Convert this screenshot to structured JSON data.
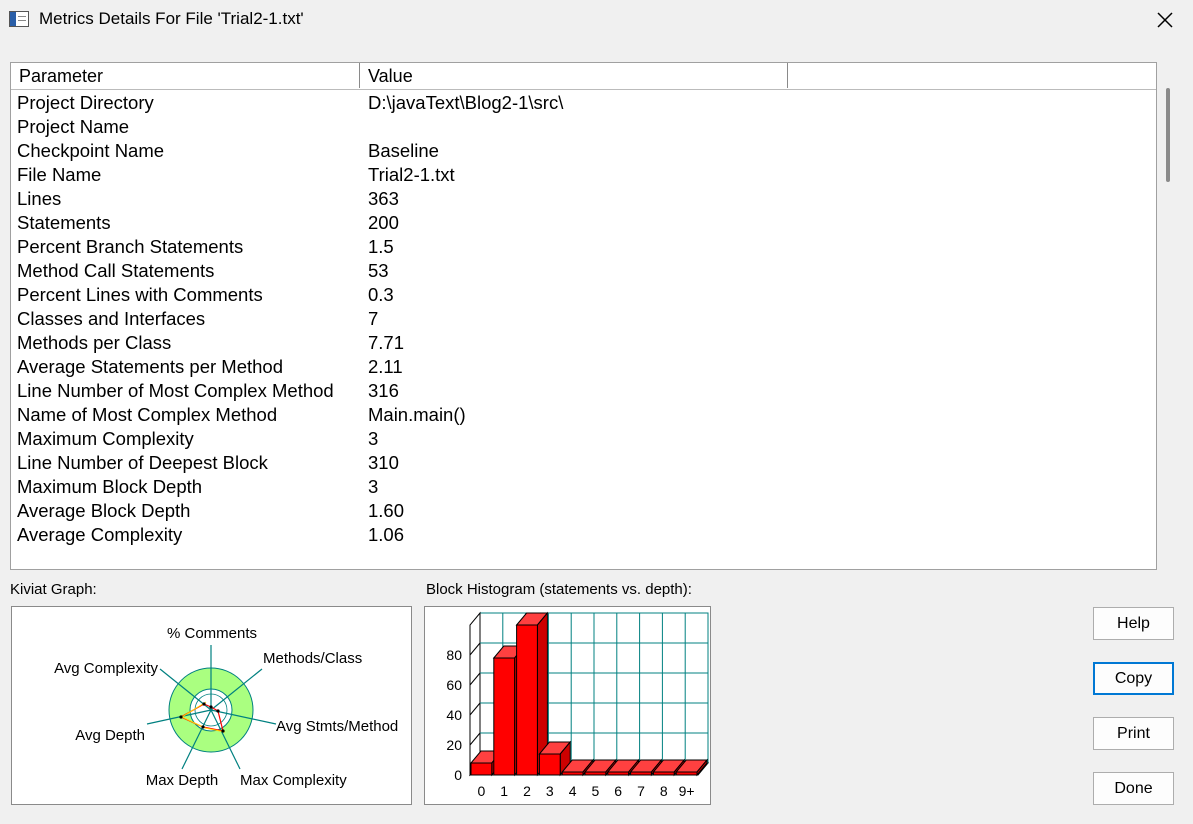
{
  "window": {
    "title": "Metrics Details For File 'Trial2-1.txt'"
  },
  "table": {
    "columns": [
      "Parameter",
      "Value",
      ""
    ],
    "rows": [
      {
        "param": "Project Directory",
        "value": "D:\\javaText\\Blog2-1\\src\\"
      },
      {
        "param": "Project Name",
        "value": ""
      },
      {
        "param": "Checkpoint Name",
        "value": "Baseline"
      },
      {
        "param": "File Name",
        "value": "Trial2-1.txt"
      },
      {
        "param": "Lines",
        "value": "363"
      },
      {
        "param": "Statements",
        "value": "200"
      },
      {
        "param": "Percent Branch Statements",
        "value": "1.5"
      },
      {
        "param": "Method Call Statements",
        "value": "53"
      },
      {
        "param": "Percent Lines with Comments",
        "value": "0.3"
      },
      {
        "param": "Classes and Interfaces",
        "value": "7"
      },
      {
        "param": "Methods per Class",
        "value": "7.71"
      },
      {
        "param": "Average Statements per Method",
        "value": "2.11"
      },
      {
        "param": "Line Number of Most Complex Method",
        "value": "316"
      },
      {
        "param": "Name of Most Complex Method",
        "value": "Main.main()"
      },
      {
        "param": "Maximum Complexity",
        "value": "3"
      },
      {
        "param": "Line Number of Deepest Block",
        "value": "310"
      },
      {
        "param": "Maximum Block Depth",
        "value": "3"
      },
      {
        "param": "Average Block Depth",
        "value": "1.60"
      },
      {
        "param": "Average Complexity",
        "value": "1.06"
      }
    ]
  },
  "kiviat": {
    "label": "Kiviat Graph:",
    "axes": [
      "% Comments",
      "Methods/Class",
      "Avg Stmts/Method",
      "Max Complexity",
      "Max Depth",
      "Avg Depth",
      "Avg Complexity"
    ]
  },
  "histogram": {
    "label": "Block Histogram (statements vs. depth):"
  },
  "chart_data": [
    {
      "type": "bar",
      "categories": [
        "0",
        "1",
        "2",
        "3",
        "4",
        "5",
        "6",
        "7",
        "8",
        "9+"
      ],
      "values": [
        8,
        78,
        100,
        14,
        0,
        0,
        0,
        0,
        0,
        0
      ],
      "ylim": [
        0,
        100
      ],
      "yticks": [
        "0",
        "20",
        "40",
        "60",
        "80"
      ],
      "grid": true,
      "bar_color": "#ff0000",
      "grid_color": "#008080"
    }
  ],
  "buttons": {
    "help": "Help",
    "copy": "Copy",
    "print": "Print",
    "done": "Done"
  },
  "colors": {
    "kiviat_band": "#aaff80",
    "axis": "#008080",
    "bar": "#ff0000"
  },
  "icons": {
    "app": "window-app-icon",
    "close": "close-icon"
  }
}
